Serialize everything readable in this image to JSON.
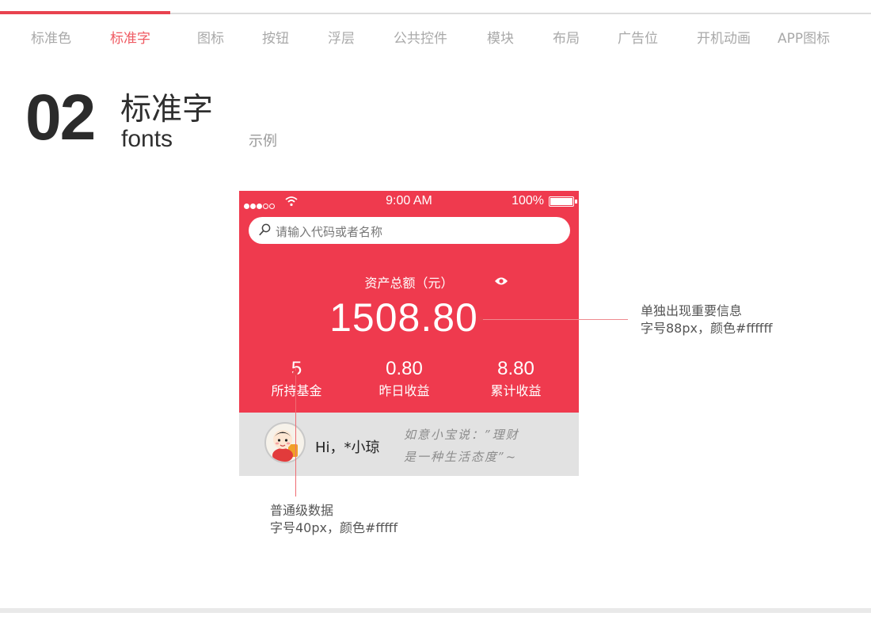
{
  "nav": {
    "items": [
      {
        "label": "标准色",
        "active": false
      },
      {
        "label": "标准字",
        "active": true
      },
      {
        "label": "图标",
        "active": false
      },
      {
        "label": "按钮",
        "active": false
      },
      {
        "label": "浮层",
        "active": false
      },
      {
        "label": "公共控件",
        "active": false
      },
      {
        "label": "模块",
        "active": false
      },
      {
        "label": "布局",
        "active": false
      },
      {
        "label": "广告位",
        "active": false
      },
      {
        "label": "开机动画",
        "active": false
      },
      {
        "label": "APP图标",
        "active": false
      }
    ]
  },
  "section": {
    "number": "02",
    "title": "标准字",
    "subtitle": "fonts",
    "example_label": "示例"
  },
  "phone": {
    "status": {
      "time": "9:00 AM",
      "battery": "100%"
    },
    "search": {
      "placeholder": "请输入代码或者名称"
    },
    "asset": {
      "label": "资产总额（元）",
      "amount": "1508.80"
    },
    "stats": [
      {
        "value": "5",
        "label": "所持基金"
      },
      {
        "value": "0.80",
        "label": "昨日收益"
      },
      {
        "value": "8.80",
        "label": "累计收益"
      }
    ],
    "profile": {
      "greeting": "Hi，*小琼",
      "quote_line1": "如意小宝说：”理财",
      "quote_line2": "是一种生活态度”~"
    }
  },
  "annotations": {
    "large": {
      "line1": "单独出现重要信息",
      "line2": "字号88px，颜色#ffffff"
    },
    "normal": {
      "line1": "普通级数据",
      "line2": "字号40px，颜色#fffff"
    }
  },
  "colors": {
    "accent": "#ef3a4e",
    "nav_active": "#ef5a62",
    "nav_inactive": "#a9a9a9"
  }
}
